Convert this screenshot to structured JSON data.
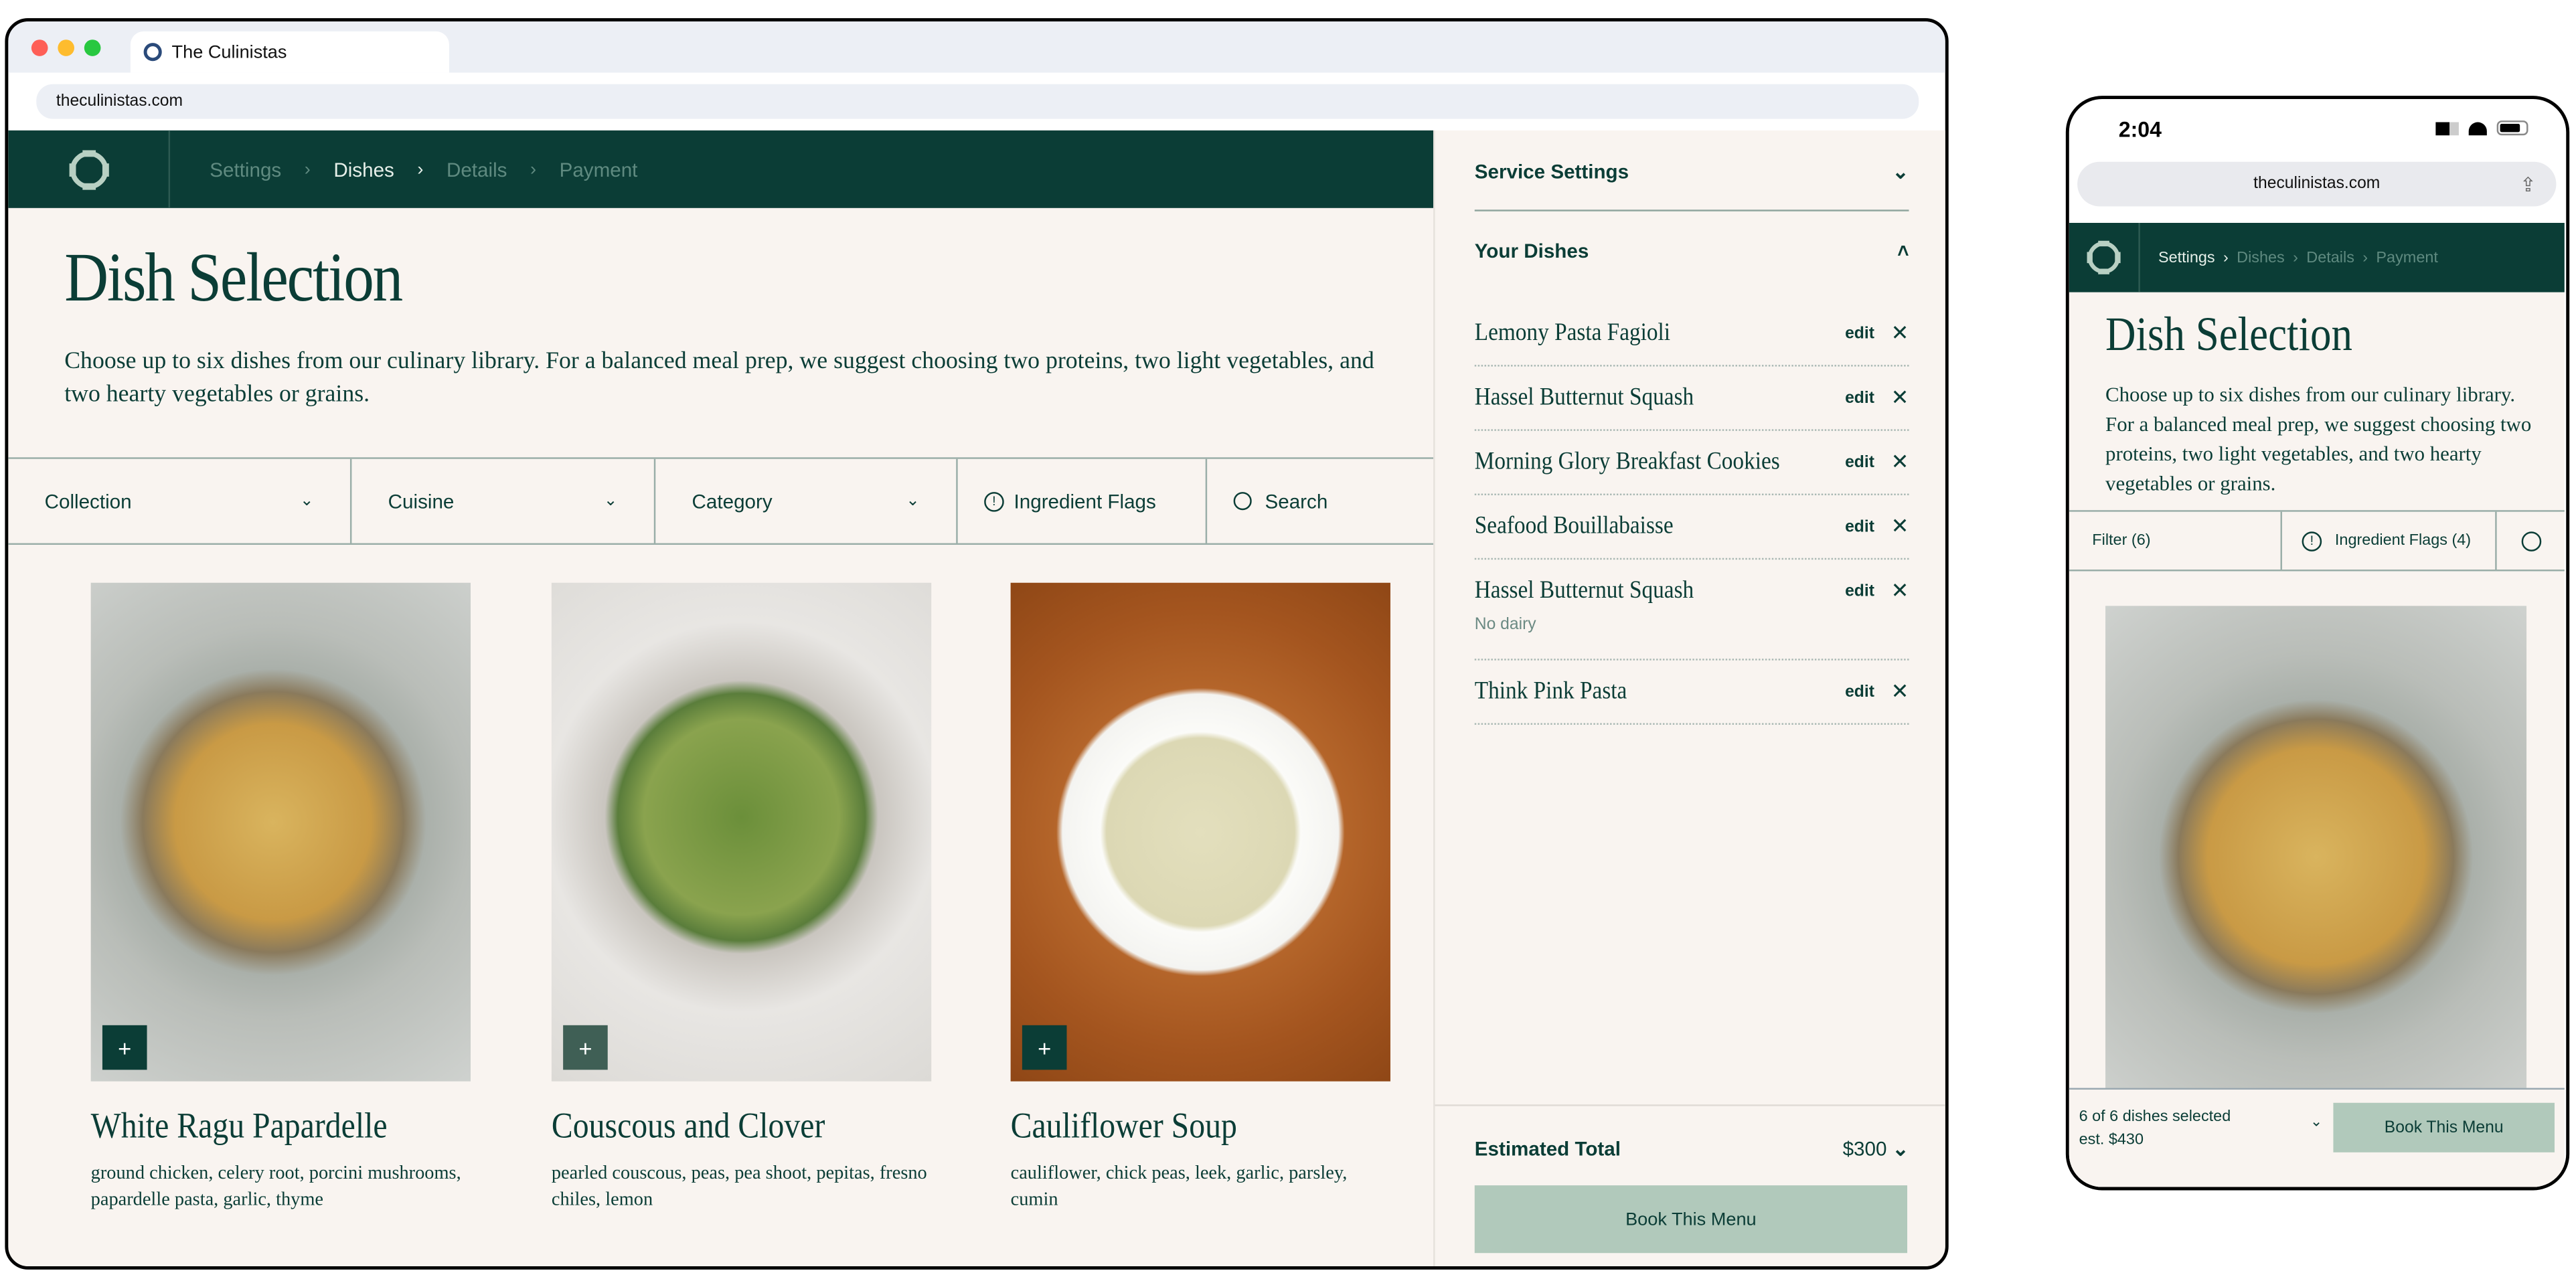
{
  "browser": {
    "tab_title": "The Culinistas",
    "url": "theculinistas.com"
  },
  "nav": {
    "breadcrumbs": [
      "Settings",
      "Dishes",
      "Details",
      "Payment"
    ],
    "current": "Dishes"
  },
  "page": {
    "title": "Dish Selection",
    "description": "Choose up to six dishes from our culinary library. For a balanced meal prep, we suggest choosing two proteins, two light vegetables, and two hearty vegetables or grains."
  },
  "filters": {
    "collection": "Collection",
    "cuisine": "Cuisine",
    "category": "Category",
    "ingredient_flags": "Ingredient Flags",
    "search": "Search"
  },
  "dishes": [
    {
      "name": "White Ragu Papardelle",
      "ingredients": "ground chicken, celery root, porcini mushrooms, papardelle pasta, garlic, thyme"
    },
    {
      "name": "Couscous and Clover",
      "ingredients": "pearled couscous, peas, pea shoot, pepitas, fresno chiles, lemon"
    },
    {
      "name": "Cauliflower Soup",
      "ingredients": "cauliflower, chick peas, leek, garlic, parsley, cumin"
    }
  ],
  "add_label": "+",
  "sidebar": {
    "service_settings": "Service Settings",
    "your_dishes": "Your Dishes",
    "edit_label": "edit",
    "selected": [
      {
        "name": "Lemony Pasta Fagioli",
        "note": ""
      },
      {
        "name": "Hassel Butternut Squash",
        "note": ""
      },
      {
        "name": "Morning Glory Breakfast Cookies",
        "note": ""
      },
      {
        "name": "Seafood Bouillabaisse",
        "note": ""
      },
      {
        "name": "Hassel Butternut Squash",
        "note": "No dairy"
      },
      {
        "name": "Think Pink Pasta",
        "note": ""
      }
    ],
    "estimated_total_label": "Estimated Total",
    "estimated_total": "$300",
    "book_button": "Book This Menu"
  },
  "mobile": {
    "time": "2:04",
    "url": "theculinistas.com",
    "breadcrumbs": [
      "Settings",
      "Dishes",
      "Details",
      "Payment"
    ],
    "title": "Dish Selection",
    "description": "Choose up to six dishes from our culinary library. For a balanced meal prep, we suggest choosing two proteins, two light vegetables, and two hearty vegetables or grains.",
    "filter": "Filter (6)",
    "ingredient_flags": "Ingredient Flags (4)",
    "selected_count": "6 of 6 dishes selected",
    "estimate": "est. $430",
    "book_button": "Book This Menu"
  },
  "colors": {
    "brand": "#0b3d36",
    "background": "#f9f4f0",
    "button": "#b1c9bb"
  }
}
